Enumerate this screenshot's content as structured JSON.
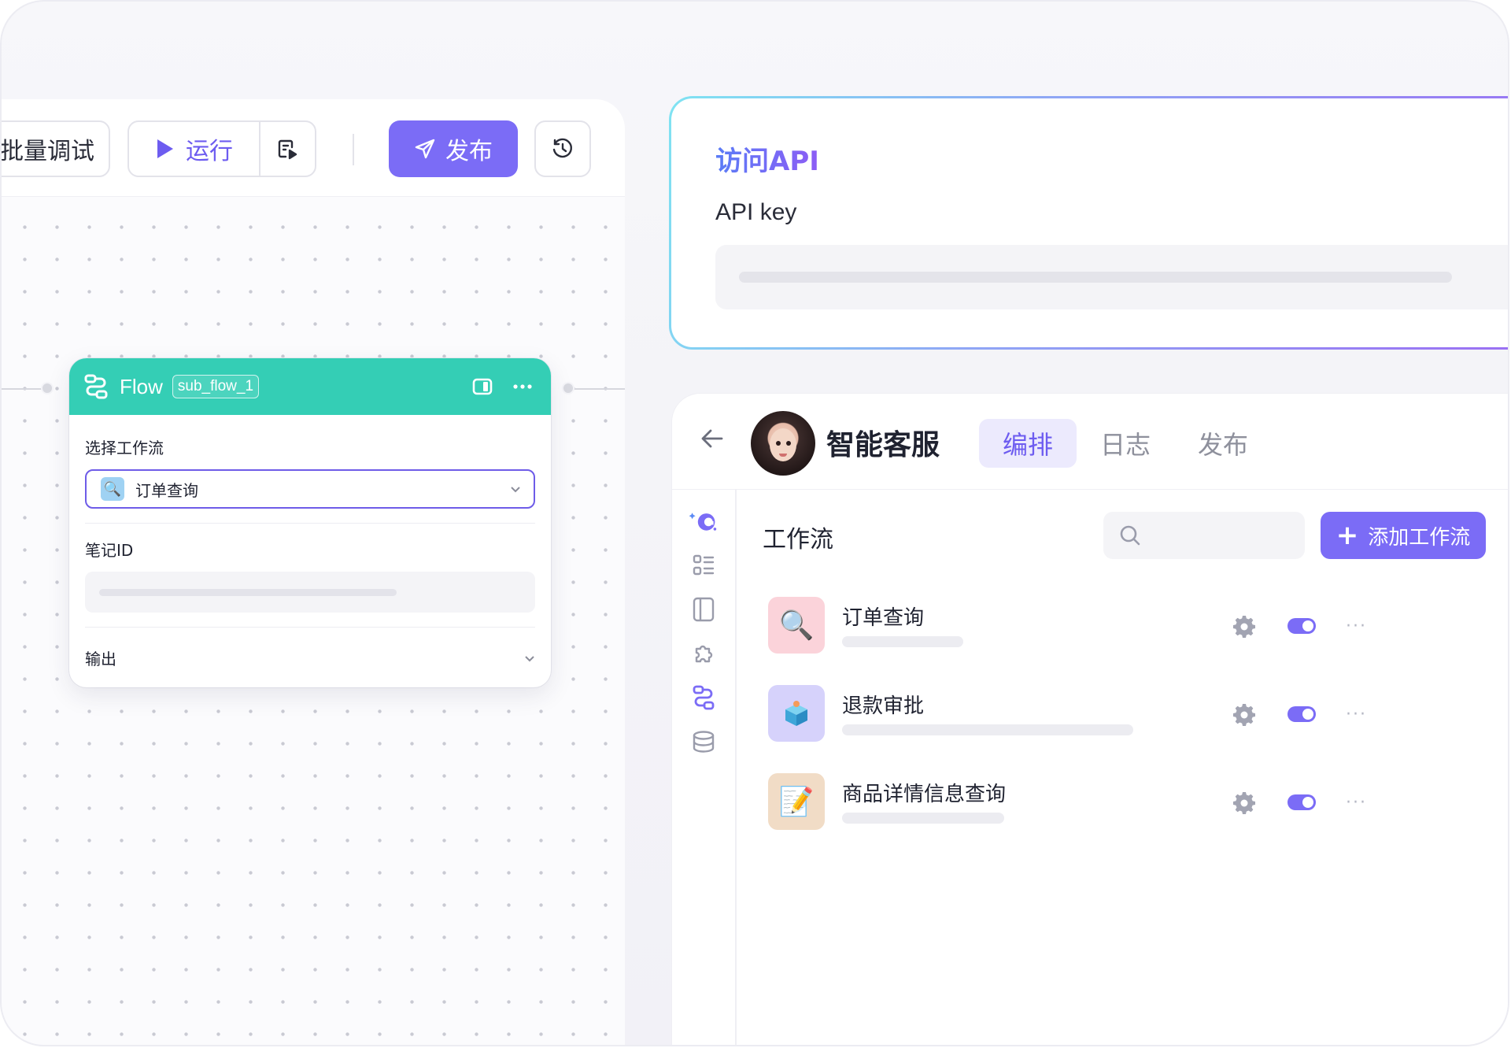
{
  "toolbar": {
    "batch_debug_label": "批量调试",
    "run_label": "运行",
    "publish_label": "发布"
  },
  "flow_node": {
    "title": "Flow",
    "tag": "sub_flow_1",
    "select_workflow_label": "选择工作流",
    "selected_workflow": "订单查询",
    "note_id_label": "笔记ID",
    "output_label": "输出"
  },
  "api_card": {
    "title": "访问API",
    "key_label": "API key"
  },
  "agent": {
    "name": "智能客服",
    "tabs": [
      {
        "label": "编排",
        "active": true
      },
      {
        "label": "日志",
        "active": false
      },
      {
        "label": "发布",
        "active": false
      }
    ],
    "workflow_section_title": "工作流",
    "add_workflow_label": "添加工作流",
    "workflows": [
      {
        "name": "订单查询",
        "icon": "magnifier-icon",
        "thumb_color": "#fbd3da",
        "enabled": true
      },
      {
        "name": "退款审批",
        "icon": "box-icon",
        "thumb_color": "#d6d2fb",
        "enabled": true
      },
      {
        "name": "商品详情信息查询",
        "icon": "memo-icon",
        "thumb_color": "#f1dcc6",
        "enabled": true
      }
    ]
  },
  "colors": {
    "accent": "#7b6cf6",
    "flow_header": "#34ceb5"
  }
}
